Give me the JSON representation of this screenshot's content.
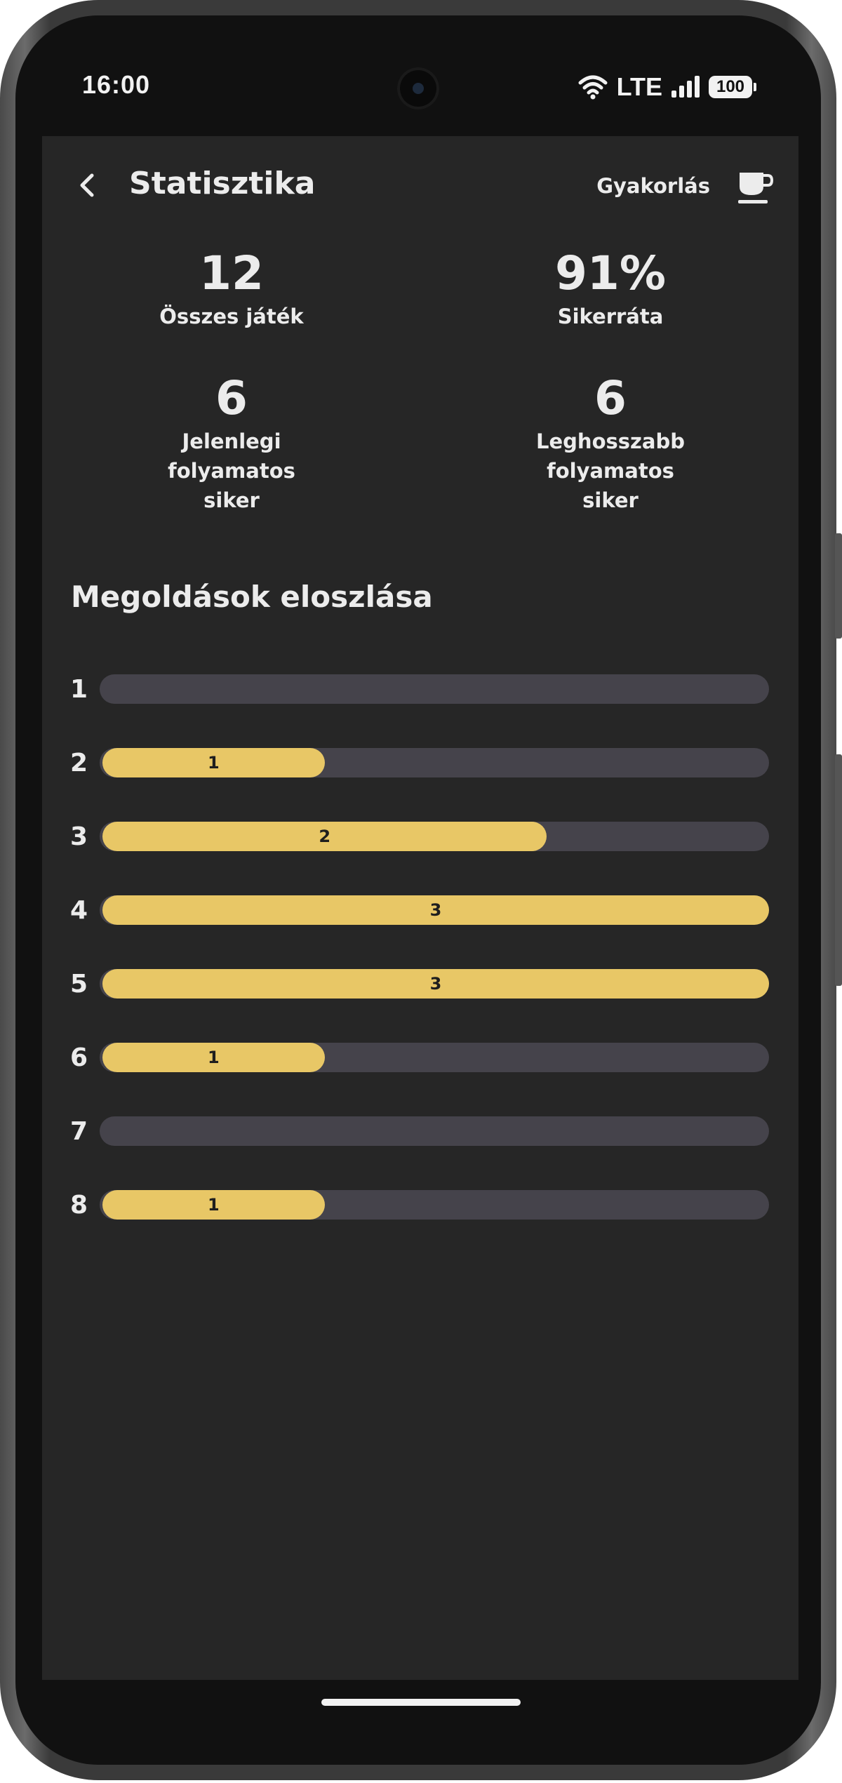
{
  "status_bar": {
    "time": "16:00",
    "network": "LTE",
    "battery": "100",
    "icons": [
      "wifi-icon",
      "signal-icon",
      "battery-icon"
    ]
  },
  "app_bar": {
    "title": "Statisztika",
    "practice_label": "Gyakorlás",
    "icons": [
      "back-arrow-icon",
      "coffee-cup-icon"
    ]
  },
  "stats": [
    {
      "value": "12",
      "label": "Összes játék"
    },
    {
      "value": "91%",
      "label": "Sikerráta"
    },
    {
      "value": "6",
      "label": "Jelenlegi folyamatos siker"
    },
    {
      "value": "6",
      "label": "Leghosszabb folyamatos siker"
    }
  ],
  "distribution": {
    "title": "Megoldások eloszlása",
    "rows": [
      {
        "guess": "1",
        "count": 0,
        "count_label": ""
      },
      {
        "guess": "2",
        "count": 1,
        "count_label": "1"
      },
      {
        "guess": "3",
        "count": 2,
        "count_label": "2"
      },
      {
        "guess": "4",
        "count": 3,
        "count_label": "3"
      },
      {
        "guess": "5",
        "count": 3,
        "count_label": "3"
      },
      {
        "guess": "6",
        "count": 1,
        "count_label": "1"
      },
      {
        "guess": "7",
        "count": 0,
        "count_label": ""
      },
      {
        "guess": "8",
        "count": 1,
        "count_label": "1"
      }
    ],
    "max": 3
  },
  "colors": {
    "background": "#262626",
    "bar_fill": "#e8c766",
    "bar_track": "#45434b",
    "text": "#ececec"
  }
}
